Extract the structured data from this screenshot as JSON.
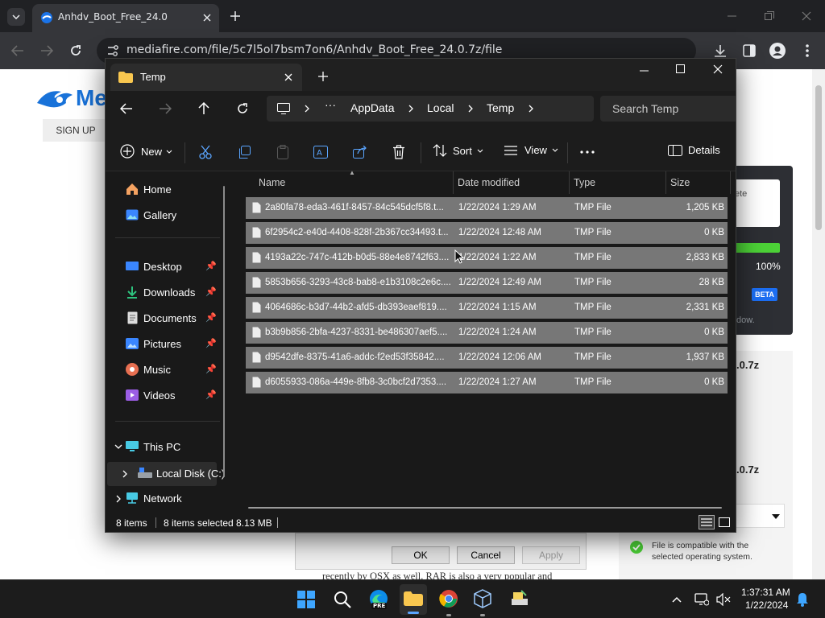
{
  "browser": {
    "tab_title": "Anhdv_Boot_Free_24.0",
    "url": "mediafire.com/file/5c7l5ol7bsm7on6/Anhdv_Boot_Free_24.0.7z/file"
  },
  "website": {
    "logo_text": "Me",
    "signup_label": "SIGN UP",
    "partial_fragment_1": "ete",
    "percent": "100%",
    "beta_badge": "BETA",
    "partial_fragment_2": "dow.",
    "filename_fragment_1": ".0.7z",
    "filename_fragment_2": ".0.7z",
    "compat_text_1": "File is compatible with the",
    "compat_text_2": "selected operating system.",
    "bottom_text": "recently by OSX as well. RAR is also a very popular and",
    "dialog_ok": "OK",
    "dialog_cancel": "Cancel",
    "dialog_apply": "Apply"
  },
  "explorer": {
    "window_title": "Temp",
    "breadcrumb": [
      "AppData",
      "Local",
      "Temp"
    ],
    "search_placeholder": "Search Temp",
    "commands": {
      "new": "New",
      "sort": "Sort",
      "view": "View",
      "details": "Details"
    },
    "sidebar": {
      "home": "Home",
      "gallery": "Gallery",
      "desktop": "Desktop",
      "downloads": "Downloads",
      "documents": "Documents",
      "pictures": "Pictures",
      "music": "Music",
      "videos": "Videos",
      "this_pc": "This PC",
      "local_disk": "Local Disk (C:)",
      "network": "Network"
    },
    "columns": {
      "name": "Name",
      "date": "Date modified",
      "type": "Type",
      "size": "Size"
    },
    "files": [
      {
        "name": "2a80fa78-eda3-461f-8457-84c545dcf5f8.t...",
        "date": "1/22/2024 1:29 AM",
        "type": "TMP File",
        "size": "1,205 KB"
      },
      {
        "name": "6f2954c2-e40d-4408-828f-2b367cc34493.t...",
        "date": "1/22/2024 12:48 AM",
        "type": "TMP File",
        "size": "0 KB"
      },
      {
        "name": "4193a22c-747c-412b-b0d5-88e4e8742f63....",
        "date": "1/22/2024 1:22 AM",
        "type": "TMP File",
        "size": "2,833 KB"
      },
      {
        "name": "5853b656-3293-43c8-bab8-e1b3108c2e6c....",
        "date": "1/22/2024 12:49 AM",
        "type": "TMP File",
        "size": "28 KB"
      },
      {
        "name": "4064686c-b3d7-44b2-afd5-db393eaef819....",
        "date": "1/22/2024 1:15 AM",
        "type": "TMP File",
        "size": "2,331 KB"
      },
      {
        "name": "b3b9b856-2bfa-4237-8331-be486307aef5....",
        "date": "1/22/2024 1:24 AM",
        "type": "TMP File",
        "size": "0 KB"
      },
      {
        "name": "d9542dfe-8375-41a6-addc-f2ed53f35842....",
        "date": "1/22/2024 12:06 AM",
        "type": "TMP File",
        "size": "1,937 KB"
      },
      {
        "name": "d6055933-086a-449e-8fb8-3c0bcf2d7353....",
        "date": "1/22/2024 1:27 AM",
        "type": "TMP File",
        "size": "0 KB"
      }
    ],
    "status": {
      "count": "8 items",
      "selected": "8 items selected",
      "size": "8.13 MB"
    }
  },
  "taskbar": {
    "time": "1:37:31 AM",
    "date": "1/22/2024",
    "edge_badge": "PRE"
  },
  "colors": {
    "accent": "#0078d4",
    "explorer_bg": "#191919",
    "selection": "#777777",
    "progress": "#4cd137"
  }
}
